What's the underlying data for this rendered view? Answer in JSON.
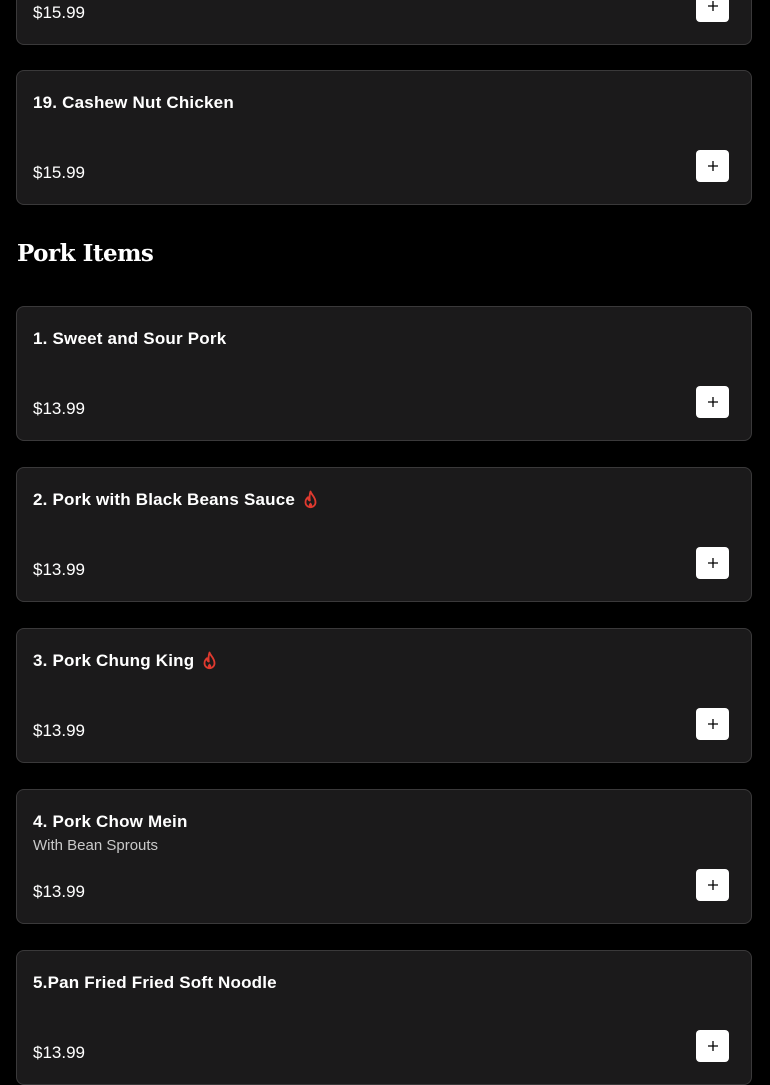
{
  "section": {
    "title": "Pork Items"
  },
  "top_items": [
    {
      "name": "",
      "price": "$15.99",
      "add_icon": "plus-icon"
    },
    {
      "name": "19. Cashew Nut Chicken",
      "price": "$15.99",
      "add_icon": "plus-icon"
    }
  ],
  "pork_items": [
    {
      "name": "1. Sweet and Sour Pork",
      "description": "",
      "price": "$13.99",
      "spicy": false
    },
    {
      "name": "2. Pork with Black Beans Sauce",
      "description": "",
      "price": "$13.99",
      "spicy": true
    },
    {
      "name": "3. Pork Chung King",
      "description": "",
      "price": "$13.99",
      "spicy": true
    },
    {
      "name": "4. Pork Chow Mein",
      "description": "With Bean Sprouts",
      "price": "$13.99",
      "spicy": false
    },
    {
      "name": "5.Pan Fried Fried Soft Noodle",
      "description": "",
      "price": "$13.99",
      "spicy": false
    }
  ],
  "icons": {
    "add": "plus-icon",
    "spicy": "flame-icon"
  },
  "colors": {
    "background": "#000000",
    "card": "#1b1a1b",
    "card_border": "#3a393a",
    "spicy": "#e03a2f",
    "add_button": "#ffffff"
  }
}
